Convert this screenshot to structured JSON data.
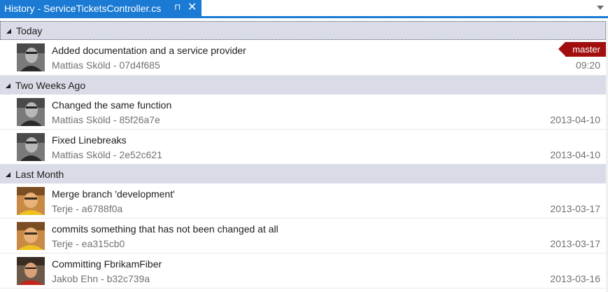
{
  "tab": {
    "title": "History - ServiceTicketsController.cs",
    "pin_icon": "pin-icon",
    "close_icon": "close-icon",
    "pin_glyph": "⊓",
    "close_glyph": "✕",
    "accent": "#1a7ad4"
  },
  "groups": [
    {
      "label": "Today",
      "commits": [
        {
          "message": "Added documentation and a service provider",
          "meta": "Mattias Sköld - 07d4f685",
          "date": "09:20",
          "branch": "master",
          "avatar": "mattias"
        }
      ]
    },
    {
      "label": "Two Weeks Ago",
      "commits": [
        {
          "message": "Changed the same function",
          "meta": "Mattias Sköld - 85f26a7e",
          "date": "2013-04-10",
          "avatar": "mattias"
        },
        {
          "message": "Fixed Linebreaks",
          "meta": "Mattias Sköld - 2e52c621",
          "date": "2013-04-10",
          "avatar": "mattias"
        }
      ]
    },
    {
      "label": "Last Month",
      "commits": [
        {
          "message": "Merge branch 'development'",
          "meta": "Terje - a6788f0a",
          "date": "2013-03-17",
          "avatar": "terje"
        },
        {
          "message": "commits something that has not been changed at all",
          "meta": "Terje - ea315cb0",
          "date": "2013-03-17",
          "avatar": "terje"
        },
        {
          "message": "Committing FbrikamFiber",
          "meta": "Jakob Ehn - b32c739a",
          "date": "2013-03-16",
          "avatar": "jakob"
        }
      ]
    }
  ],
  "colors": {
    "group_header_bg": "#d9dbe6",
    "branch_tag_bg": "#a20e0e",
    "secondary_text": "#717171"
  }
}
